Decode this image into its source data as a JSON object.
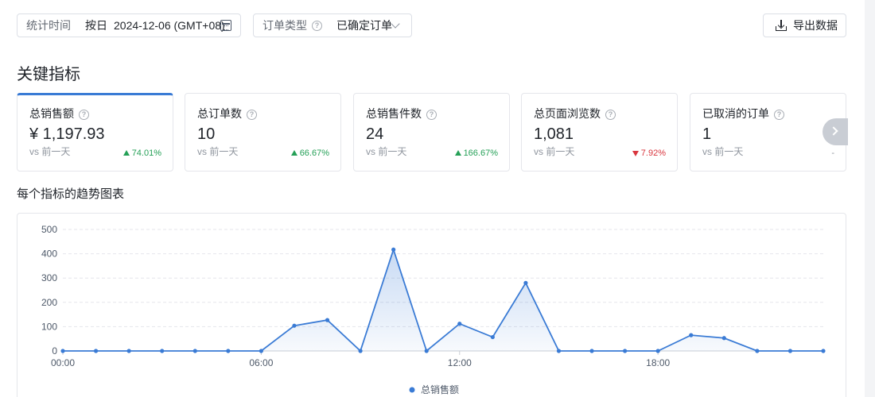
{
  "filters": {
    "time": {
      "label": "统计时间",
      "mode": "按日",
      "value": "2024-12-06 (GMT+08)"
    },
    "order_type": {
      "label": "订单类型",
      "value": "已确定订单"
    }
  },
  "export_label": "导出数据",
  "section_title": "关键指标",
  "trend_title": "每个指标的趋势图表",
  "help_glyph": "?",
  "cards": [
    {
      "name": "总销售额",
      "value": "¥ 1,197.93",
      "compare": "vs 前一天",
      "delta": "74.01%",
      "direction": "up"
    },
    {
      "name": "总订单数",
      "value": "10",
      "compare": "vs 前一天",
      "delta": "66.67%",
      "direction": "up"
    },
    {
      "name": "总销售件数",
      "value": "24",
      "compare": "vs 前一天",
      "delta": "166.67%",
      "direction": "up"
    },
    {
      "name": "总页面浏览数",
      "value": "1,081",
      "compare": "vs 前一天",
      "delta": "7.92%",
      "direction": "down"
    },
    {
      "name": "已取消的订单",
      "value": "1",
      "compare": "vs 前一天",
      "delta": "-",
      "direction": "none"
    }
  ],
  "colors": {
    "accent": "#3a7bd5",
    "up": "#25a057",
    "down": "#d9363e"
  },
  "chart_data": {
    "type": "area",
    "x": [
      "00:00",
      "01:00",
      "02:00",
      "03:00",
      "04:00",
      "05:00",
      "06:00",
      "07:00",
      "08:00",
      "09:00",
      "10:00",
      "11:00",
      "12:00",
      "13:00",
      "14:00",
      "15:00",
      "16:00",
      "17:00",
      "18:00",
      "19:00",
      "20:00",
      "21:00",
      "22:00",
      "23:00"
    ],
    "x_tick_labels": [
      "00:00",
      "06:00",
      "12:00",
      "18:00"
    ],
    "series": [
      {
        "name": "总销售额",
        "color": "#3a7bd5",
        "values": [
          0,
          0,
          0,
          0,
          0,
          0,
          0,
          104,
          127,
          0,
          417,
          0,
          112,
          57,
          280,
          0,
          0,
          0,
          0,
          65,
          53,
          0,
          0,
          0
        ]
      }
    ],
    "ylim": [
      0,
      500
    ],
    "yticks": [
      0,
      100,
      200,
      300,
      400,
      500
    ],
    "grid": true,
    "legend": "bottom-center"
  }
}
